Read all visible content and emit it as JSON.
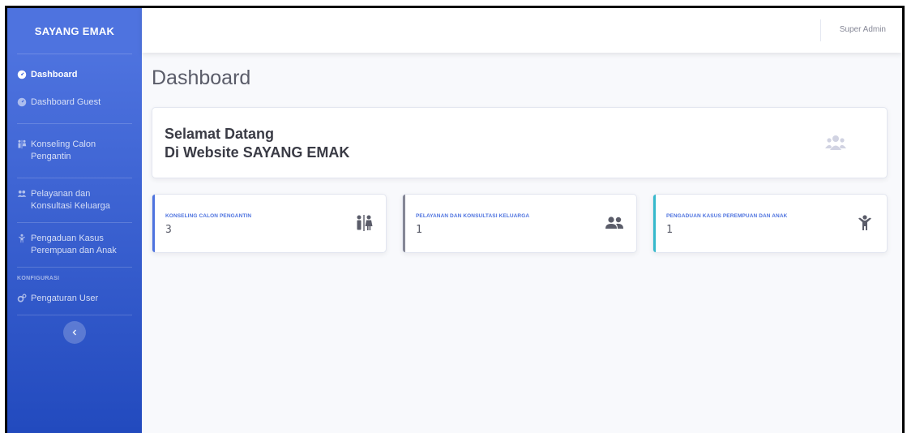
{
  "sidebar": {
    "brand": "SAYANG EMAK",
    "items": [
      {
        "label": "Dashboard",
        "icon": "tachometer-icon"
      },
      {
        "label": "Dashboard Guest",
        "icon": "tachometer-icon"
      },
      {
        "label": "Konseling Calon Pengantin",
        "icon": "restroom-icon"
      },
      {
        "label": "Pelayanan dan Konsultasi Keluarga",
        "icon": "users-icon"
      },
      {
        "label": "Pengaduan Kasus Perempuan dan Anak",
        "icon": "child-icon"
      }
    ],
    "heading": "KONFIGURASI",
    "config_items": [
      {
        "label": "Pengaturan User",
        "icon": "cogs-icon"
      }
    ],
    "toggle_icon": "chevron-left-icon",
    "gradient_top": "#4e73df",
    "gradient_bottom": "#224abe"
  },
  "topbar": {
    "user_name": "Super Admin"
  },
  "main": {
    "page_title": "Dashboard",
    "welcome": {
      "line1": "Selamat Datang",
      "line2": "Di Website SAYANG EMAK",
      "icon": "users-icon"
    },
    "stats": [
      {
        "label": "KONSELING CALON PENGANTIN",
        "value": "3",
        "accent": "#4e73df",
        "icon": "restroom-icon"
      },
      {
        "label": "PELAYANAN DAN KONSULTASI KELUARGA",
        "value": "1",
        "accent": "#858796",
        "icon": "user-friends-icon"
      },
      {
        "label": "PENGADUAN KASUS PEREMPUAN DAN ANAK",
        "value": "1",
        "accent": "#36b9cc",
        "icon": "child-icon"
      }
    ]
  }
}
